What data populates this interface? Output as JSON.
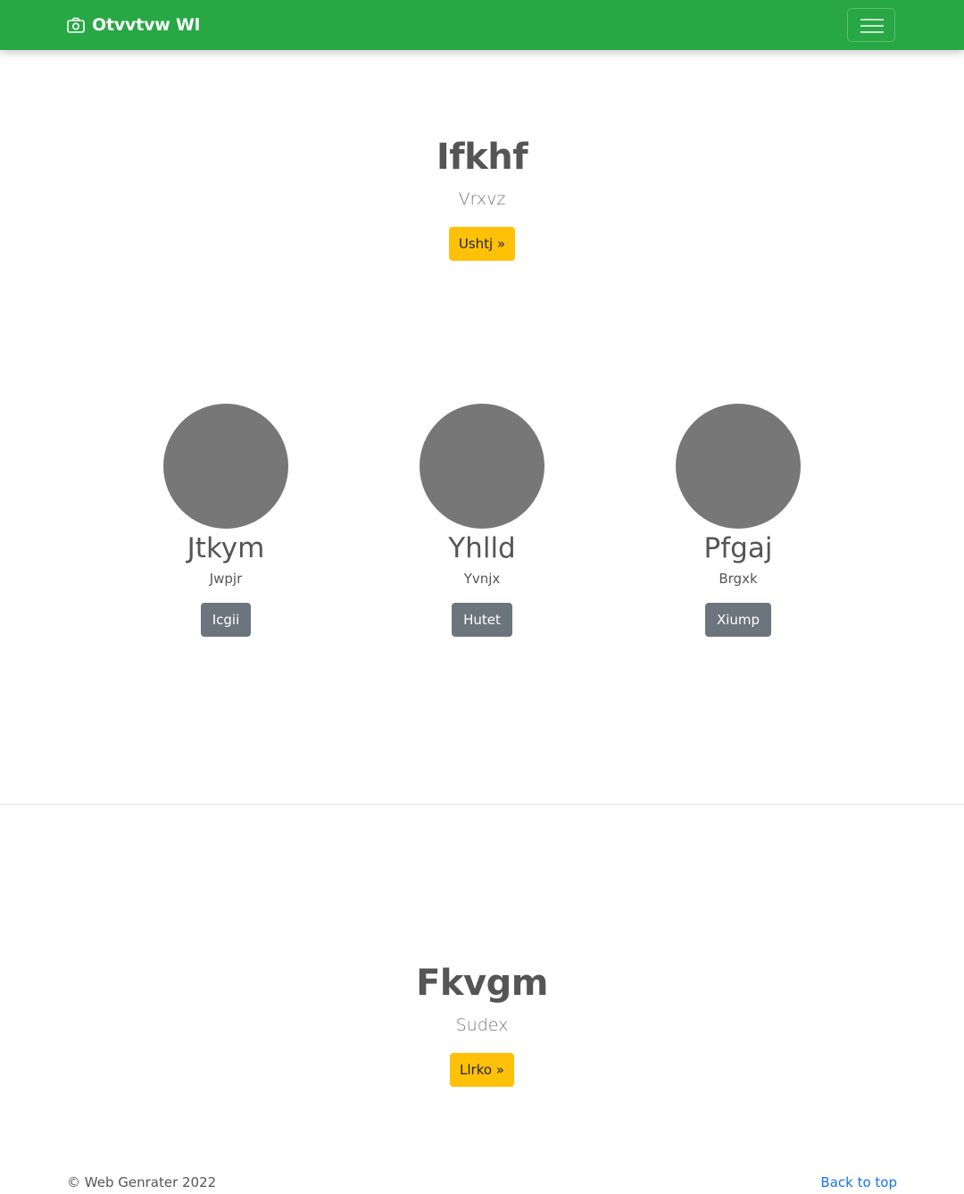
{
  "navbar": {
    "brand": "Otvvtvw Wl",
    "brand_icon": "camera-icon",
    "toggler_icon": "hamburger-menu-icon",
    "background": "#28a745"
  },
  "hero1": {
    "title": "Ifkhf",
    "subtitle": "Vrxvz",
    "button": "Ushtj »"
  },
  "features": [
    {
      "title": "Jtkym",
      "text": "Jwpjr",
      "button": "Icgii"
    },
    {
      "title": "Yhlld",
      "text": "Yvnjx",
      "button": "Hutet"
    },
    {
      "title": "Pfgaj",
      "text": "Brgxk",
      "button": "Xiump"
    }
  ],
  "hero2": {
    "title": "Fkvgm",
    "subtitle": "Sudex",
    "button": "Llrko »"
  },
  "footer": {
    "copyright": "© Web Genrater 2022",
    "back_to_top": "Back to top"
  },
  "colors": {
    "primary_green": "#28a745",
    "warning": "#ffc107",
    "secondary": "#6c757d",
    "link": "#1a73e8",
    "placeholder_circle": "#777777"
  }
}
